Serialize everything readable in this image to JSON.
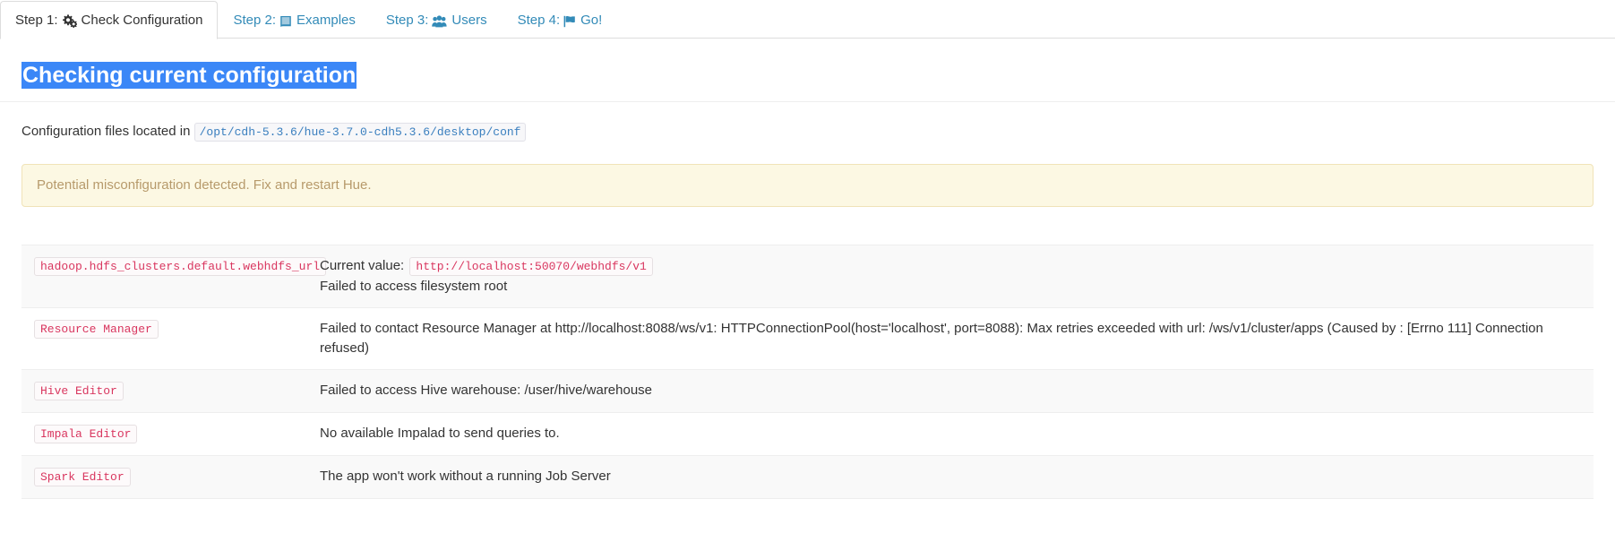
{
  "tabs": [
    {
      "label_prefix": "Step 1:",
      "label": "Check Configuration",
      "icon": "cogs-icon",
      "active": true
    },
    {
      "label_prefix": "Step 2:",
      "label": "Examples",
      "icon": "book-icon",
      "active": false
    },
    {
      "label_prefix": "Step 3:",
      "label": "Users",
      "icon": "users-icon",
      "active": false
    },
    {
      "label_prefix": "Step 4:",
      "label": "Go!",
      "icon": "flag-icon",
      "active": false
    }
  ],
  "page": {
    "title": "Checking current configuration",
    "config_label": "Configuration files located in",
    "config_path": "/opt/cdh-5.3.6/hue-3.7.0-cdh5.3.6/desktop/conf",
    "alert": "Potential misconfiguration detected. Fix and restart Hue.",
    "title_highlight_color": "#3b87f7",
    "alert_bg_color": "#fcf8e3",
    "alert_text_color": "#b79a6b"
  },
  "checks": [
    {
      "key": "hadoop.hdfs_clusters.default.webhdfs_url",
      "current_value_label": "Current value:",
      "current_value": "http://localhost:50070/webhdfs/v1",
      "message": "Failed to access filesystem root"
    },
    {
      "key": "Resource Manager",
      "current_value_label": "",
      "current_value": "",
      "message": "Failed to contact Resource Manager at http://localhost:8088/ws/v1: HTTPConnectionPool(host='localhost', port=8088): Max retries exceeded with url: /ws/v1/cluster/apps (Caused by : [Errno 111] Connection refused)"
    },
    {
      "key": "Hive Editor",
      "current_value_label": "",
      "current_value": "",
      "message": "Failed to access Hive warehouse: /user/hive/warehouse"
    },
    {
      "key": "Impala Editor",
      "current_value_label": "",
      "current_value": "",
      "message": "No available Impalad to send queries to."
    },
    {
      "key": "Spark Editor",
      "current_value_label": "",
      "current_value": "",
      "message": "The app won't work without a running Job Server"
    }
  ]
}
